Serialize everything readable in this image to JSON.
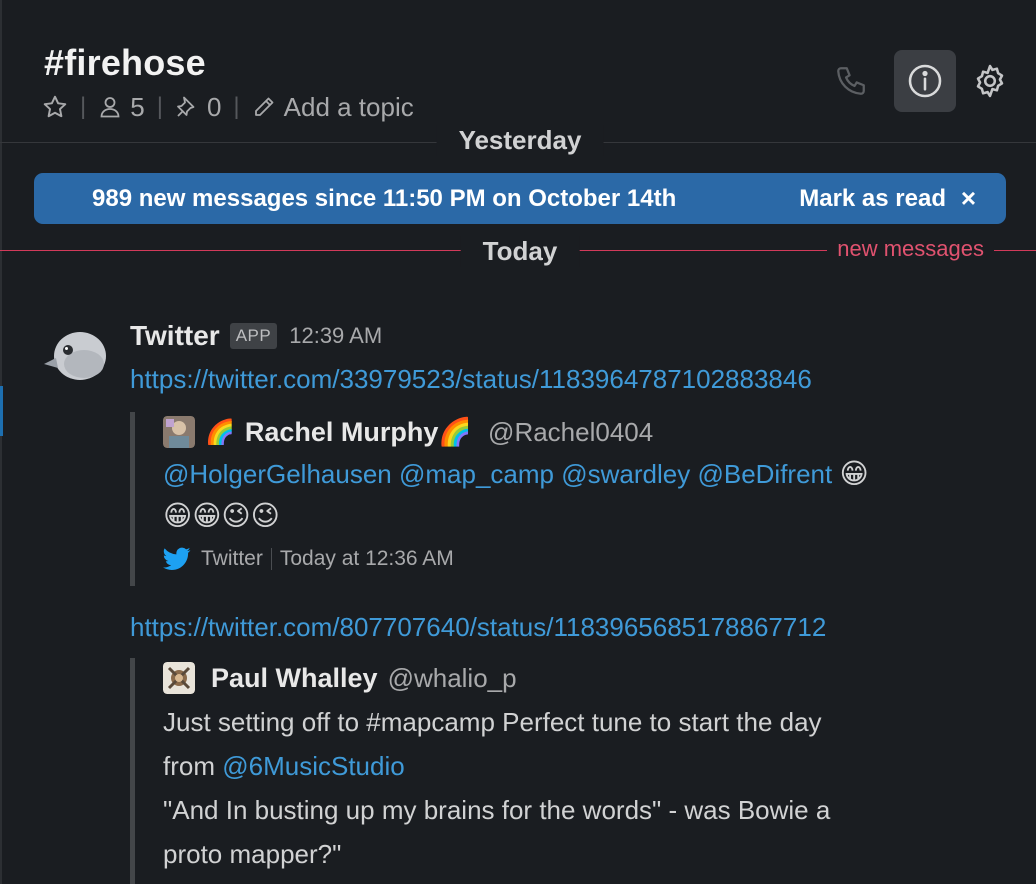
{
  "header": {
    "channel_title": "#firehose",
    "members_count": "5",
    "pins_count": "0",
    "add_topic": "Add a topic"
  },
  "dividers": {
    "yesterday": "Yesterday",
    "today": "Today",
    "new_messages": "new messages"
  },
  "banner": {
    "message": "989 new messages since 11:50 PM on October 14th",
    "mark_as_read": "Mark as read",
    "close": "×"
  },
  "message": {
    "sender": "Twitter",
    "badge": "APP",
    "time": "12:39 AM",
    "links": [
      "https://twitter.com/33979523/status/1183964787102883846",
      "https://twitter.com/807707640/status/1183965685178867712"
    ]
  },
  "tweets": [
    {
      "author_name": "Rachel Murphy🌈",
      "author_prefix": "🌈",
      "handle": "@Rachel0404",
      "mentions": [
        "@HolgerGelhausen",
        "@map_camp",
        "@swardley",
        "@BeDifrent"
      ],
      "emoji_line1": "😁",
      "emoji_line2": "😁😁😉😉",
      "source": "Twitter",
      "timestamp": "Today at 12:36 AM"
    },
    {
      "author_name": "Paul Whalley",
      "handle": "@whalio_p",
      "line1": "Just setting off to #mapcamp Perfect tune to start the day",
      "line2_prefix": "from ",
      "line2_mention": "@6MusicStudio",
      "line3": "\"And In busting up my brains for the words\" - was Bowie a",
      "line4": "proto mapper?\""
    }
  ],
  "colors": {
    "background": "#1a1d21",
    "banner": "#2b69a7",
    "link": "#3f9ad8",
    "new_divider": "#d23a5a"
  },
  "icons": [
    "star-icon",
    "members-icon",
    "pin-icon",
    "pencil-icon",
    "phone-icon",
    "info-icon",
    "gear-icon",
    "twitter-bird-icon",
    "avatar-bird-icon"
  ]
}
